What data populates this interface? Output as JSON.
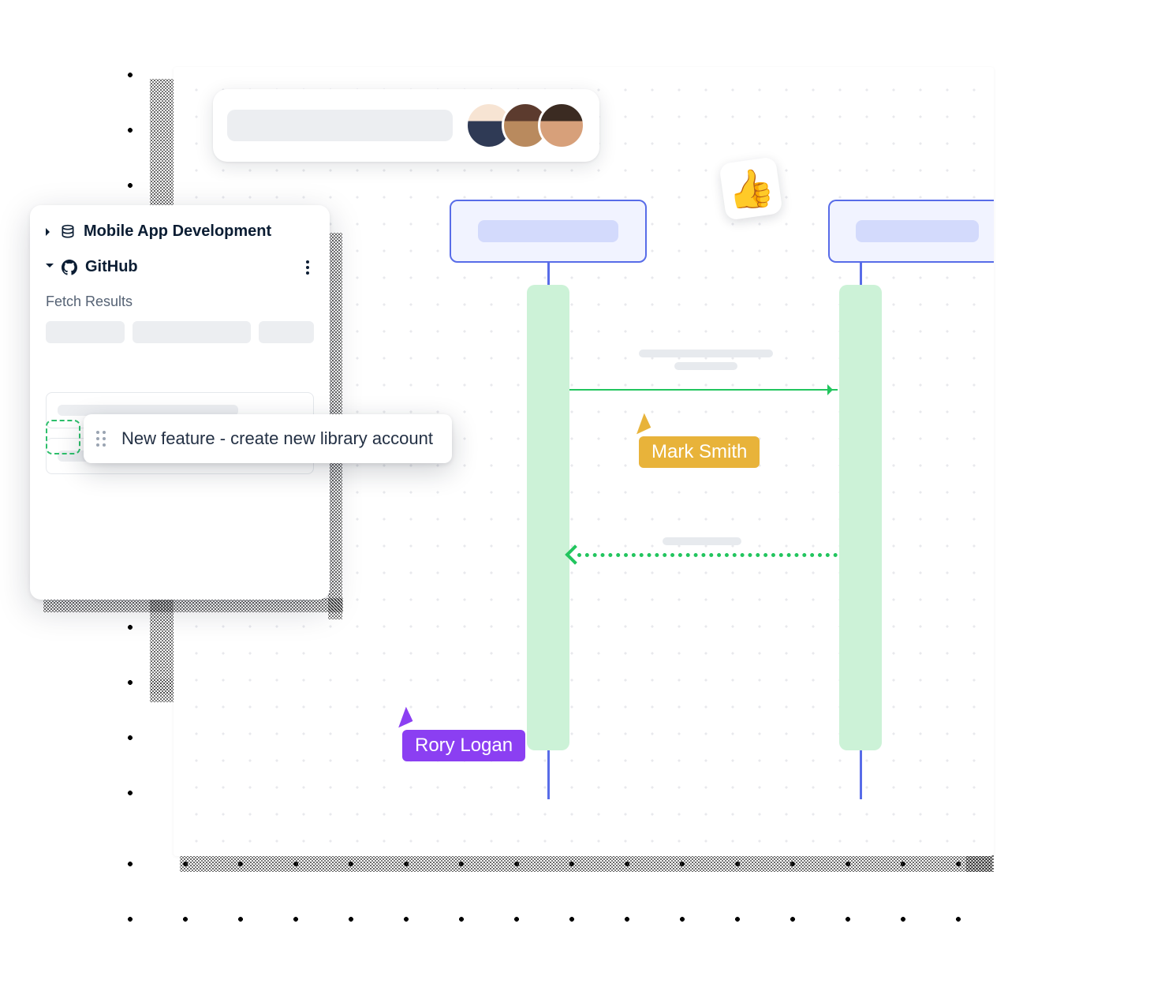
{
  "sidebar": {
    "project_title": "Mobile App Development",
    "integration_title": "GitHub",
    "section_label": "Fetch Results"
  },
  "drag_card": {
    "title": "New feature - create new library account"
  },
  "cursors": {
    "yellow": "Mark Smith",
    "purple": "Rory Logan"
  },
  "sticker": {
    "thumb": "👍"
  }
}
